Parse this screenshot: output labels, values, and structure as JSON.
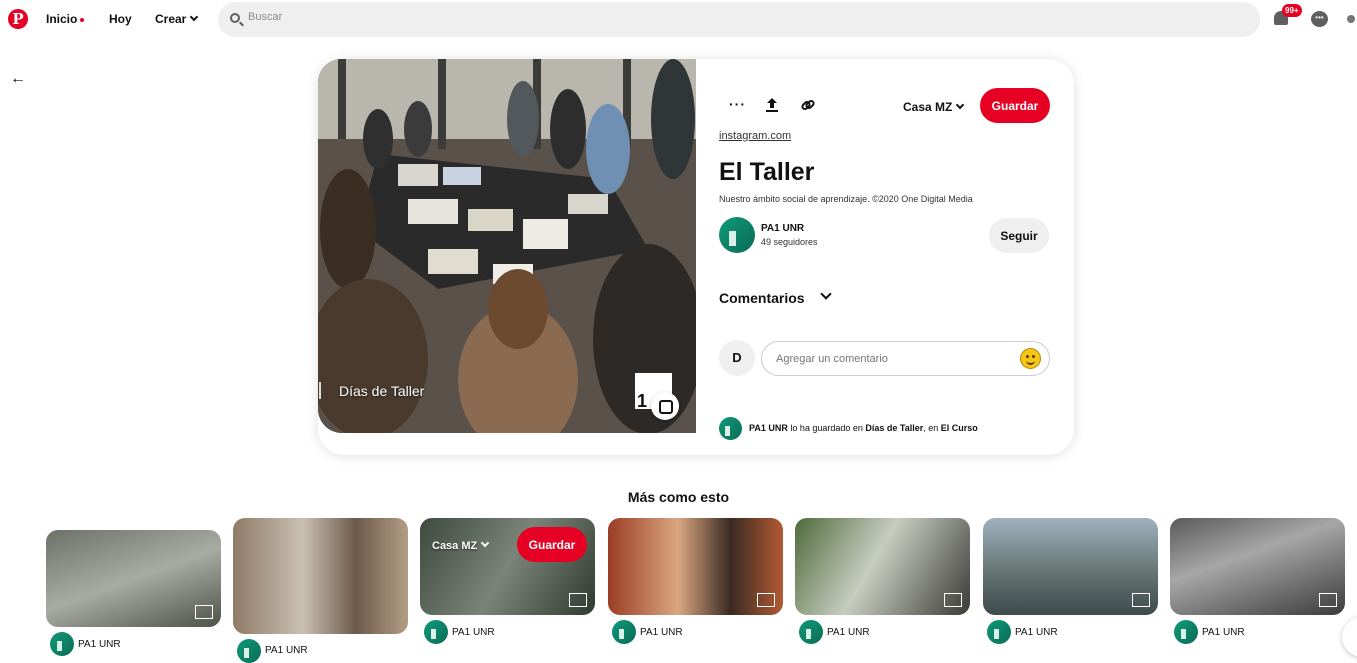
{
  "nav": {
    "home": "Inicio",
    "today": "Hoy",
    "create": "Crear",
    "search_placeholder": "Buscar",
    "notifications_badge": "99+"
  },
  "pin": {
    "more_label": "···",
    "board_select": "Casa MZ",
    "save_label": "Guardar",
    "source": "instagram.com",
    "title": "El Taller",
    "description": "Nuestro ámbito social de aprendizaje. ©2020 One Digital Media",
    "owner_name": "PA1 UNR",
    "owner_followers": "49 seguidores",
    "follow_label": "Seguir",
    "comments_title": "Comentarios",
    "user_initial": "D",
    "comment_placeholder": "Agregar un comentario",
    "image_caption": "Días de Taller",
    "image_thumb_text": "1",
    "saved_by": "PA1 UNR",
    "saved_text_1": " lo ha guardado en ",
    "saved_board": "Días de Taller",
    "saved_text_2": ", en ",
    "saved_section": "El Curso"
  },
  "more": {
    "title": "Más como esto",
    "overlay_board": "Casa MZ",
    "overlay_save": "Guardar",
    "tiles": [
      {
        "owner": "PA1 UNR"
      },
      {
        "owner": "PA1 UNR"
      },
      {
        "owner": "PA1 UNR"
      },
      {
        "owner": "PA1 UNR"
      },
      {
        "owner": "PA1 UNR"
      },
      {
        "owner": "PA1 UNR"
      },
      {
        "owner": "PA1 UNR"
      }
    ]
  },
  "colors": {
    "brand": "#e60023",
    "avatar": "#0f9a7a"
  }
}
